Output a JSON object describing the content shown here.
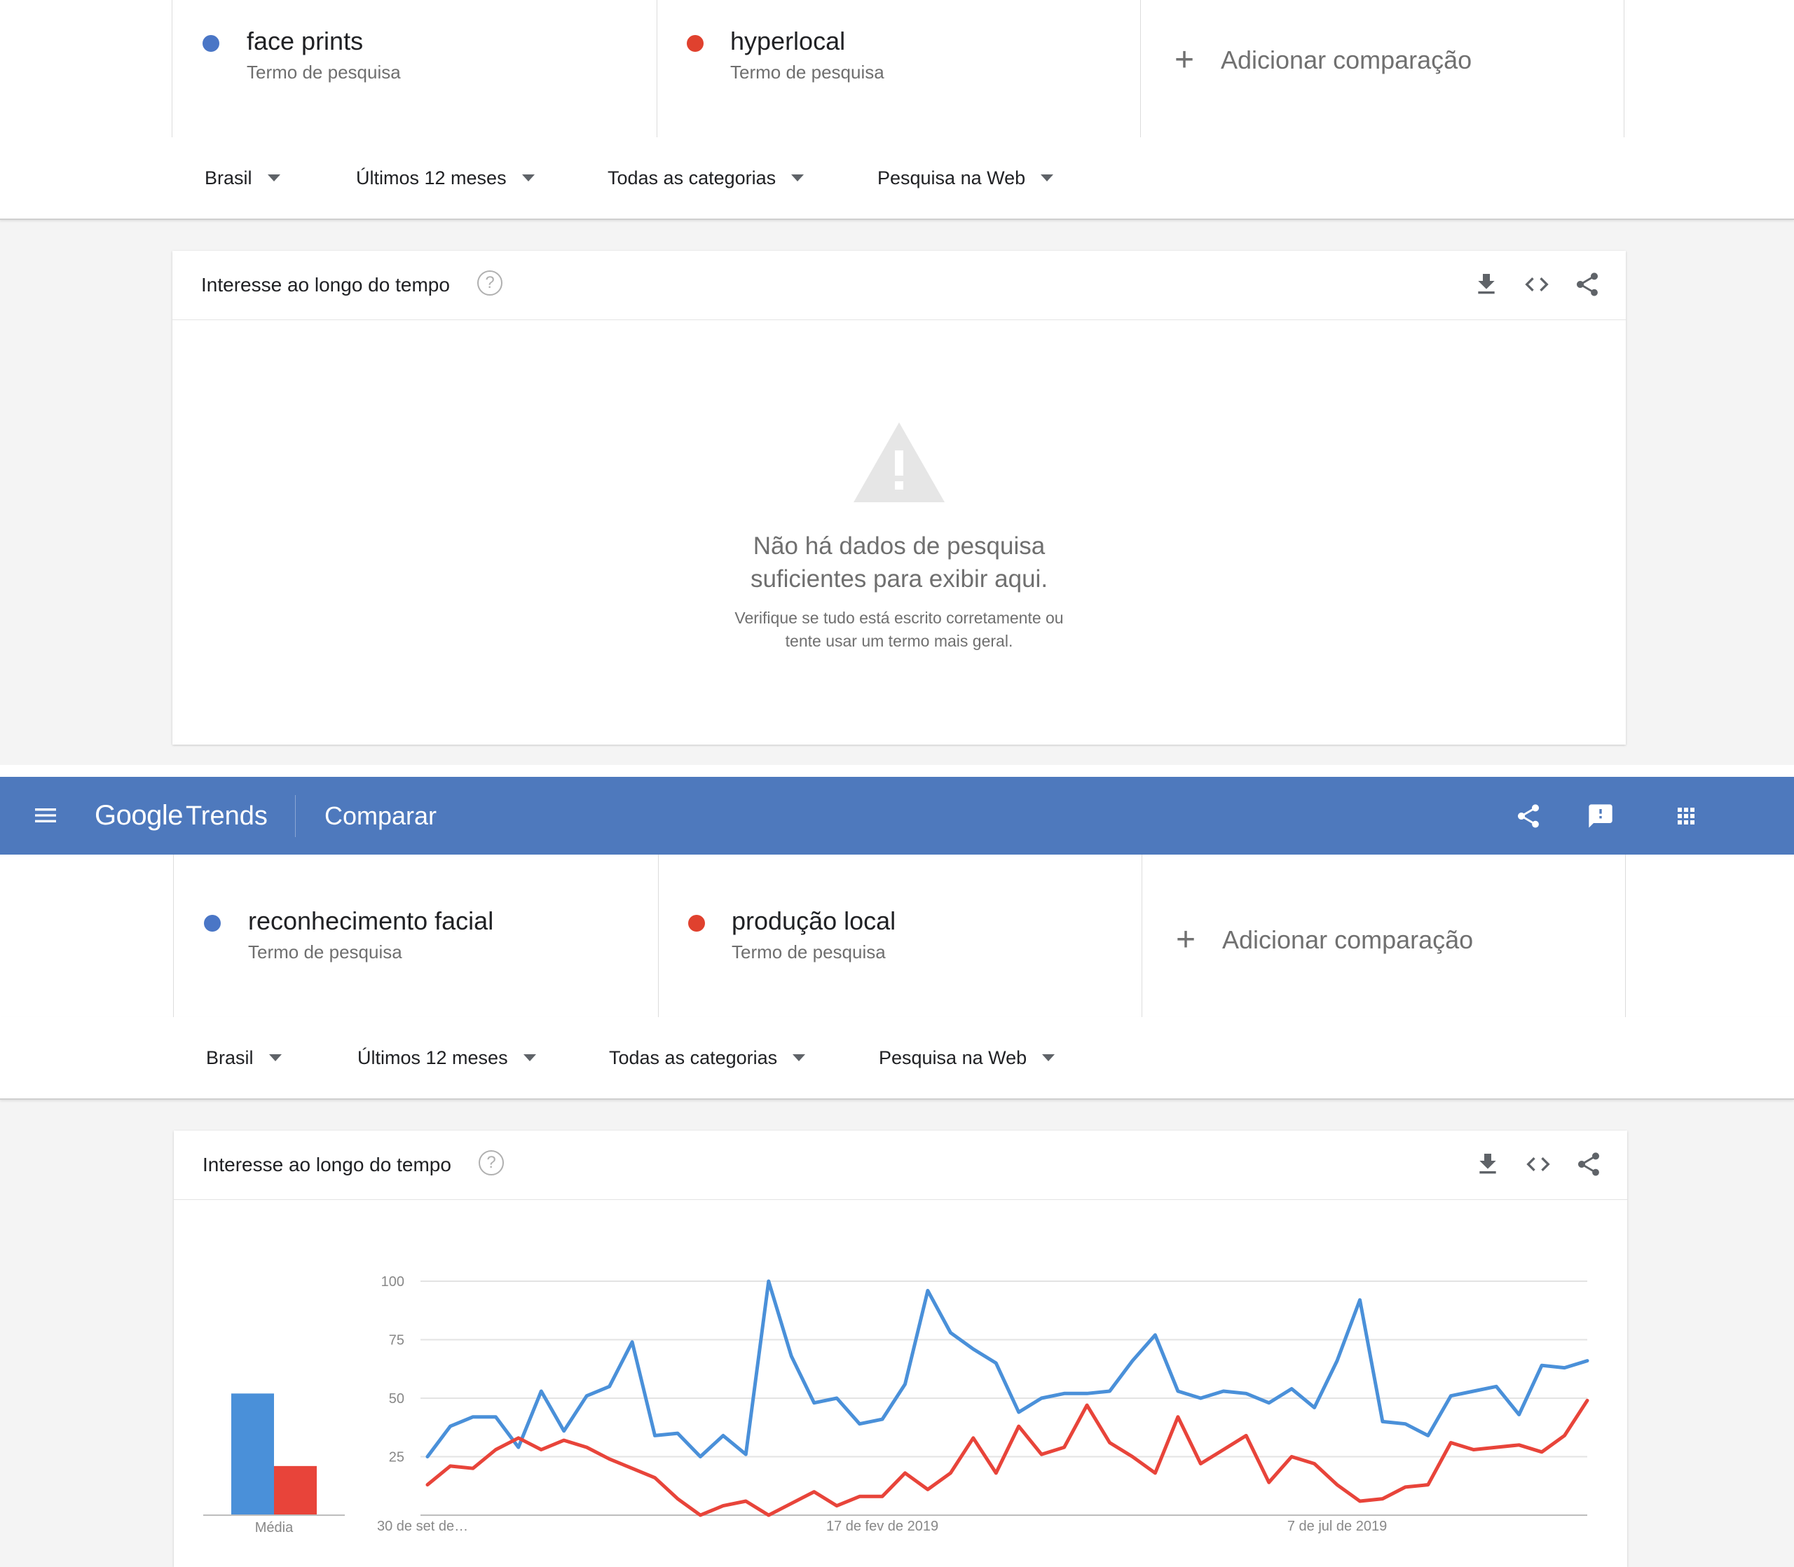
{
  "top": {
    "terms": [
      {
        "name": "face prints",
        "subtitle": "Termo de pesquisa",
        "color": "#4a76c6"
      },
      {
        "name": "hyperlocal",
        "subtitle": "Termo de pesquisa",
        "color": "#e0412e"
      }
    ],
    "add_comparison": "Adicionar comparação",
    "filters": {
      "region": "Brasil",
      "period": "Últimos 12 meses",
      "category": "Todas as categorias",
      "search_type": "Pesquisa na Web"
    },
    "widget": {
      "title": "Interesse ao longo do tempo",
      "empty_title_line1": "Não há dados de pesquisa",
      "empty_title_line2": "suficientes para exibir aqui.",
      "empty_sub_line1": "Verifique se tudo está escrito corretamente ou",
      "empty_sub_line2": "tente usar um termo mais geral."
    }
  },
  "appbar": {
    "logo_google": "Google",
    "logo_trends": "Trends",
    "title": "Comparar",
    "icons": [
      "menu-icon",
      "share-icon",
      "feedback-icon",
      "apps-grid-icon"
    ]
  },
  "bottom": {
    "terms": [
      {
        "name": "reconhecimento facial",
        "subtitle": "Termo de pesquisa",
        "color": "#4a76c6"
      },
      {
        "name": "produção local",
        "subtitle": "Termo de pesquisa",
        "color": "#e0412e"
      }
    ],
    "add_comparison": "Adicionar comparação",
    "filters": {
      "region": "Brasil",
      "period": "Últimos 12 meses",
      "category": "Todas as categorias",
      "search_type": "Pesquisa na Web"
    },
    "widget": {
      "title": "Interesse ao longo do tempo"
    }
  },
  "colors": {
    "blue": "#4a90d9",
    "red": "#e8443a",
    "appbar": "#4e79bd",
    "bar_blue": "#4a90d9",
    "bar_red": "#e8443a"
  },
  "chart_data": {
    "type": "line",
    "title": "Interesse ao longo do tempo",
    "ylim": [
      0,
      100
    ],
    "yticks": [
      25,
      50,
      75,
      100
    ],
    "x_tick_labels": [
      "30 de set de…",
      "17 de fev de 2019",
      "7 de jul de 2019"
    ],
    "x_tick_index": [
      0,
      20,
      40
    ],
    "grid": true,
    "average_label": "Média",
    "averages": [
      52,
      21
    ],
    "series": [
      {
        "name": "reconhecimento facial",
        "color": "#4a90d9",
        "values": [
          25,
          38,
          42,
          42,
          29,
          53,
          36,
          51,
          55,
          74,
          34,
          35,
          25,
          34,
          26,
          100,
          68,
          48,
          50,
          39,
          41,
          56,
          96,
          78,
          71,
          65,
          44,
          50,
          52,
          52,
          53,
          66,
          77,
          53,
          50,
          53,
          52,
          48,
          54,
          46,
          66,
          92,
          40,
          39,
          34,
          51,
          53,
          55,
          43,
          64,
          63,
          66
        ]
      },
      {
        "name": "produção local",
        "color": "#e8443a",
        "values": [
          13,
          21,
          20,
          28,
          33,
          28,
          32,
          29,
          24,
          20,
          16,
          7,
          0,
          4,
          6,
          0,
          5,
          10,
          4,
          8,
          8,
          18,
          11,
          18,
          33,
          18,
          38,
          26,
          29,
          47,
          31,
          25,
          18,
          42,
          22,
          28,
          34,
          14,
          25,
          22,
          13,
          6,
          7,
          12,
          13,
          31,
          28,
          29,
          30,
          27,
          34,
          49
        ]
      }
    ]
  }
}
